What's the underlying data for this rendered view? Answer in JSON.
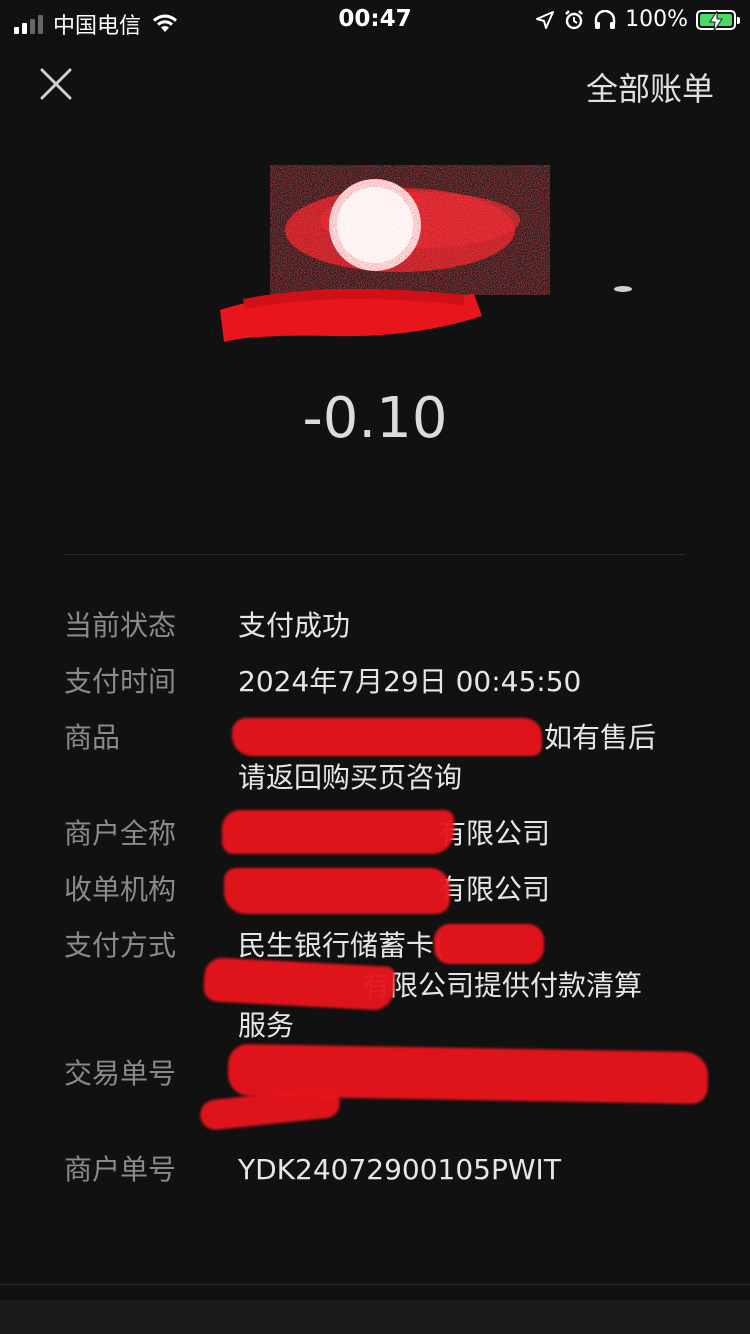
{
  "status_bar": {
    "carrier": "中国电信",
    "time": "00:47",
    "battery": "100%"
  },
  "header": {
    "close_icon": "close-icon",
    "all_bills_label": "全部账单"
  },
  "amount": "-0.10",
  "details": {
    "status": {
      "label": "当前状态",
      "value": "支付成功"
    },
    "pay_time": {
      "label": "支付时间",
      "value": "2024年7月29日 00:45:50"
    },
    "product": {
      "label": "商品",
      "value_visible": "如有售后",
      "value_line2": "请返回购买页咨询"
    },
    "merchant_name": {
      "label": "商户全称",
      "value_visible": "有限公司"
    },
    "acquirer": {
      "label": "收单机构",
      "value_visible": "有限公司"
    },
    "pay_method": {
      "label": "支付方式",
      "value": "民生银行储蓄卡(",
      "value_line2": "有限公司提供付款清算",
      "value_line3": "服务"
    },
    "trade_no": {
      "label": "交易单号"
    },
    "merchant_no": {
      "label": "商户单号",
      "value": "YDK24072900105PWIT"
    }
  },
  "colors": {
    "background": "#111111",
    "redaction": "#e8151c"
  }
}
